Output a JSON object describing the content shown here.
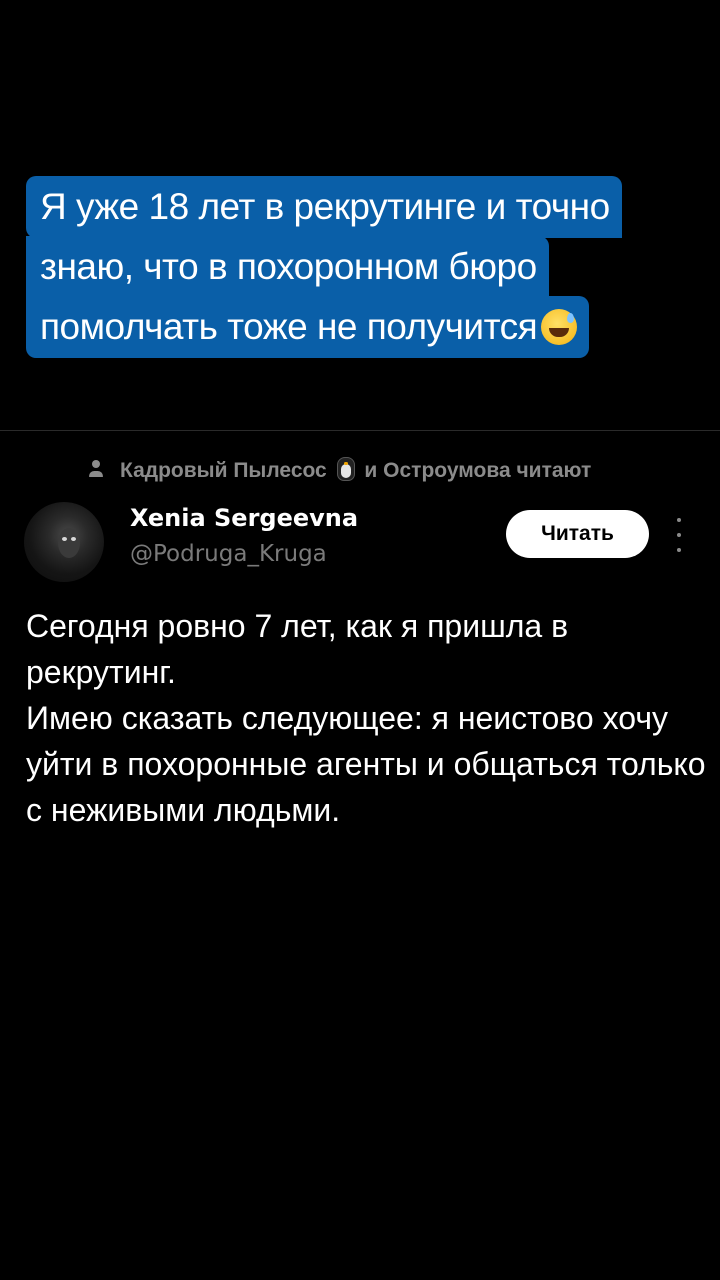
{
  "caption": {
    "lines": [
      "Я уже 18 лет в рекрутинге и точно",
      "знаю, что в похоронном бюро",
      "помолчать тоже не получится"
    ],
    "emoji": "grinning-face-with-sweat",
    "background_color": "#0a5fa8"
  },
  "tweet": {
    "social_context": {
      "name_1": "Кадровый Пылесос",
      "name_1_emoji": "penguin-icon",
      "rest": "и Остроумова читают"
    },
    "author": {
      "display_name": "Xenia Sergeevna",
      "handle": "@Podruga_Kruga"
    },
    "follow_label": "Читать",
    "text_paragraphs": [
      "Сегодня ровно 7 лет, как я пришла в рекрутинг.",
      "Имею сказать следующее: я неистово хочу уйти в похоронные агенты и общаться только с неживыми людьми."
    ]
  },
  "colors": {
    "background": "#000000",
    "muted_text": "#8b8b8b",
    "handle_text": "#7a7a7a",
    "button_bg": "#ffffff"
  }
}
